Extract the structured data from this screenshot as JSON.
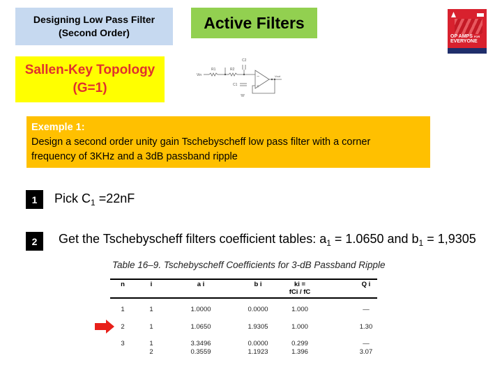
{
  "header": {
    "title_line1": "Designing Low Pass Filter",
    "title_line2": "(Second Order)",
    "section_label": "Active Filters",
    "book_cover": {
      "title_line1": "OP AMPS",
      "title_for": "FOR",
      "title_line2": "EVERYONE",
      "color": "#d8212e"
    }
  },
  "topology": {
    "line1": "Sallen-Key Topology",
    "line2": "(G=1)"
  },
  "circuit": {
    "labels": {
      "vin": "Vin",
      "r1": "R1",
      "r2": "R2",
      "c1": "C1",
      "c2": "C2",
      "vout": "Vout"
    }
  },
  "example": {
    "heading": "Exemple 1:",
    "line1": "Design a second order unity gain Tschebyscheff low pass filter with a corner",
    "line2": "frequency of 3KHz and a 3dB passband ripple"
  },
  "steps": [
    {
      "number": "1",
      "text_prefix": "Pick  C",
      "sub": "1",
      "text_suffix": " =22nF"
    },
    {
      "number": "2",
      "text_prefix": "Get the Tschebyscheff filters coefficient tables:  a",
      "sub": "1",
      "text_mid": " = 1.0650 and b",
      "sub2": "1",
      "text_suffix": " = 1,9305"
    }
  ],
  "table": {
    "title": "Table 16–9.   Tschebyscheff Coefficients for 3-dB Passband Ripple",
    "headers": [
      "n",
      "i",
      "a i",
      "b i",
      "ki =",
      "Q i"
    ],
    "header_ki_line2": "fCi / fC",
    "rows": [
      [
        "1",
        "1",
        "1.0000",
        "0.0000",
        "1.000",
        "—"
      ],
      [
        "2",
        "1",
        "1.0650",
        "1.9305",
        "1.000",
        "1.30"
      ],
      [
        "3",
        "1",
        "3.3496",
        "0.0000",
        "0.299",
        "—"
      ],
      [
        "",
        "2",
        "0.3559",
        "1.1923",
        "1.396",
        "3.07"
      ]
    ],
    "highlighted_row": 1,
    "arrow_color": "#e8201a"
  }
}
